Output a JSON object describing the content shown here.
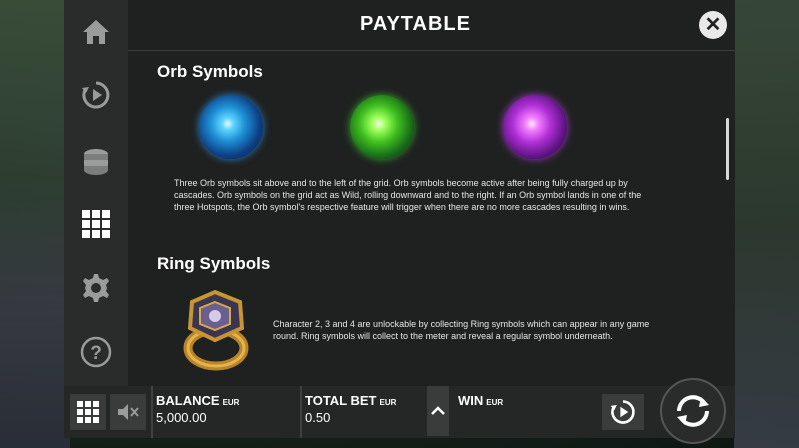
{
  "header": {
    "title": "PAYTABLE",
    "close_icon": "close-icon"
  },
  "sidebar": {
    "items": [
      {
        "name": "home",
        "icon": "home-icon"
      },
      {
        "name": "autoplay",
        "icon": "autoplay-icon"
      },
      {
        "name": "bet",
        "icon": "coins-icon"
      },
      {
        "name": "paytable",
        "icon": "grid-icon",
        "active": true
      },
      {
        "name": "settings",
        "icon": "gear-icon"
      },
      {
        "name": "help",
        "icon": "help-icon"
      }
    ]
  },
  "orb_section": {
    "title": "Orb Symbols",
    "orbs": [
      "blue-orb",
      "green-orb",
      "purple-orb"
    ],
    "description": "Three Orb symbols sit above and to the left of the grid. Orb symbols become active after being fully charged up by cascades. Orb symbols on the grid act as Wild, rolling downward and to the right. If an Orb symbol lands in one of the three Hotspots, the Orb symbol's respective feature will trigger when there are no more cascades resulting in wins."
  },
  "ring_section": {
    "title": "Ring Symbols",
    "description": "Character 2, 3 and 4 are unlockable by collecting Ring symbols which can appear in any game round. Ring symbols will collect to the meter and reveal a regular symbol underneath."
  },
  "bottom_bar": {
    "balance": {
      "label": "BALANCE",
      "currency": "EUR",
      "value": "5,000.00"
    },
    "total_bet": {
      "label": "TOTAL BET",
      "currency": "EUR",
      "value": "0.50"
    },
    "win": {
      "label": "WIN",
      "currency": "EUR",
      "value": ""
    }
  },
  "colors": {
    "panel_bg": "#1f2120",
    "sidebar_bg": "#2a2c2b",
    "text": "#ffffff"
  }
}
